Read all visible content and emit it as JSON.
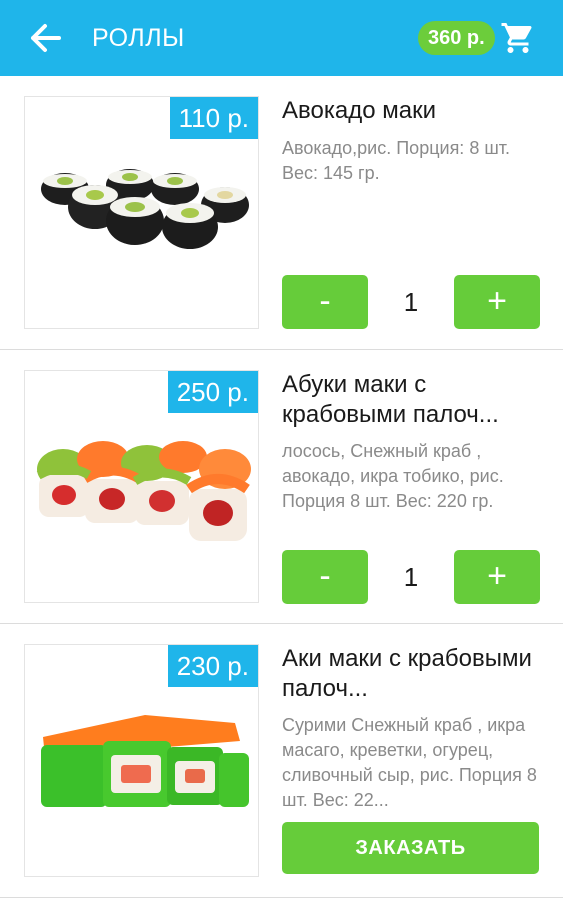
{
  "appbar": {
    "title": "РОЛЛЫ",
    "cart_total": "360 р.",
    "back_icon": "arrow-left-icon",
    "cart_icon": "shopping-cart-icon",
    "color": "#1fb5ea"
  },
  "accent_green": "#66cc3a",
  "items": [
    {
      "price": "110 р.",
      "name": "Авокадо маки",
      "description": "Авокадо,рис. Порция: 8 шт. Вес: 145 гр.",
      "quantity": "1",
      "minus_label": "-",
      "plus_label": "+"
    },
    {
      "price": "250 р.",
      "name": "Абуки маки с крабовыми палоч...",
      "description": "лосось,  Снежный краб , авокадо, икра тобико, рис. Порция 8 шт. Вес: 220 гр.",
      "quantity": "1",
      "minus_label": "-",
      "plus_label": "+"
    },
    {
      "price": "230 р.",
      "name": "Аки маки с крабовыми палоч...",
      "description": "Сурими  Снежный краб , икра масаго, креветки, огурец, сливочный сыр, рис. Порция 8 шт. Вес: 22...",
      "order_label": "ЗАКАЗАТЬ"
    }
  ]
}
